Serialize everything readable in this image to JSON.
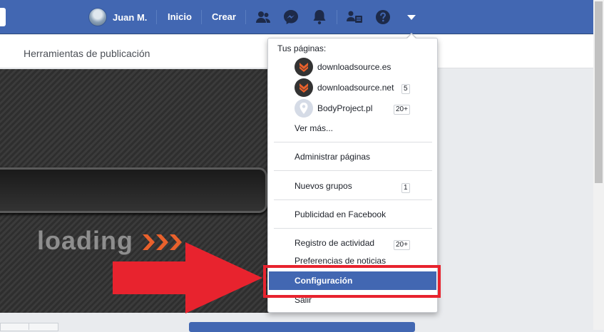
{
  "topbar": {
    "profile_name": "Juan M.",
    "home_label": "Inicio",
    "create_label": "Crear",
    "icons": [
      "friends-icon",
      "messenger-icon",
      "notifications-icon",
      "friend-requests-icon",
      "help-icon",
      "account-menu-icon"
    ]
  },
  "subheader": {
    "title": "Herramientas de publicación"
  },
  "video": {
    "overlay_text": "loading",
    "overlay_arrows": "›››"
  },
  "dropdown": {
    "section_label": "Tus páginas:",
    "pages": [
      {
        "name": "downloadsource.es",
        "badge": ""
      },
      {
        "name": "downloadsource.net",
        "badge": "5"
      },
      {
        "name": "BodyProject.pl",
        "badge": "20+"
      }
    ],
    "see_more": "Ver más...",
    "manage_pages": "Administrar páginas",
    "new_groups": "Nuevos grupos",
    "new_groups_badge": "1",
    "ads": "Publicidad en Facebook",
    "activity_log": "Registro de actividad",
    "activity_log_badge": "20+",
    "news_prefs": "Preferencias de noticias",
    "settings": "Configuración",
    "logout": "Salir"
  },
  "colors": {
    "brand": "#4267b2",
    "highlight_red": "#e8232e",
    "page_icon_orange": "#e9612c"
  }
}
